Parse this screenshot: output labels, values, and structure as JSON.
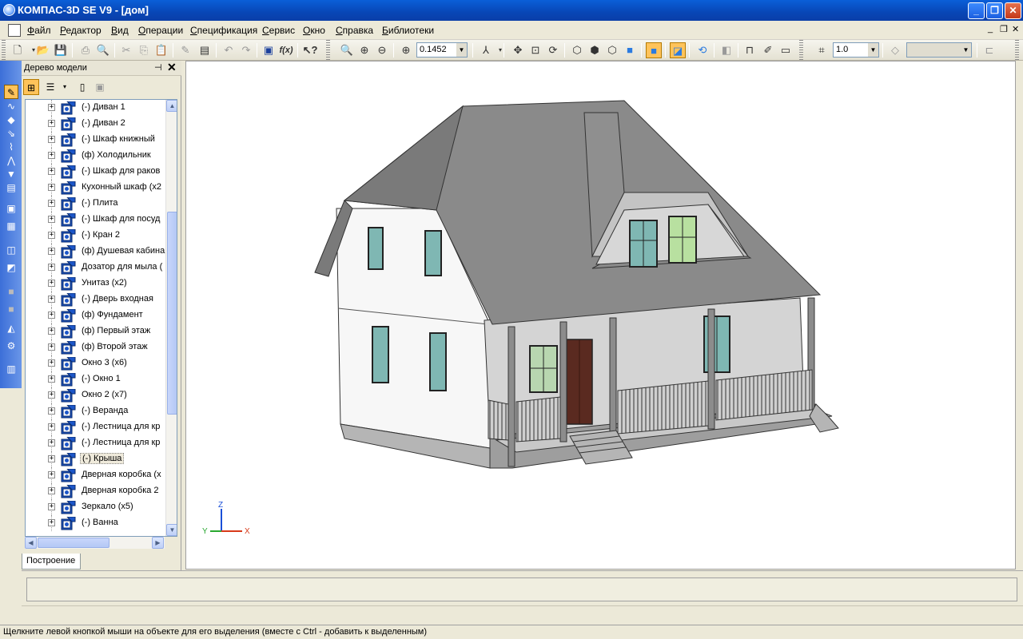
{
  "window": {
    "title": "КОМПАС-3D SE V9 - [дом]",
    "minimize_glyph": "_",
    "maximize_glyph": "❐",
    "close_glyph": "✕"
  },
  "menu": {
    "items": [
      "Файл",
      "Редактор",
      "Вид",
      "Операции",
      "Спецификация",
      "Сервис",
      "Окно",
      "Справка",
      "Библиотеки"
    ],
    "mdi_minimize": "_",
    "mdi_restore": "❐",
    "mdi_close": "✕"
  },
  "toolbar": {
    "zoom_value": "0.1452",
    "step_value": "1.0",
    "layer_value": "",
    "icons": [
      "new-document",
      "open",
      "save",
      "print",
      "print-preview",
      "cut",
      "copy",
      "paste",
      "properties",
      "undo",
      "redo",
      "insert-object",
      "variables",
      "help-pointer",
      "zoom-window",
      "zoom-in",
      "zoom-out",
      "zoom-scale",
      "orientation",
      "pan",
      "zoom-all",
      "rotate",
      "wireframe",
      "hidden-lines",
      "hidden-lines-dim",
      "halftone",
      "halftone-edges",
      "perspective",
      "rebuild",
      "section",
      "measure",
      "draw-settings",
      "show-all",
      "step"
    ]
  },
  "compact_panel": {
    "icons": [
      "edit-icon",
      "curves-icon",
      "surfaces-icon",
      "arrays-icon",
      "auxiliary-icon",
      "sketch-icon",
      "filter-icon",
      "spec-icon",
      "cube-icon",
      "open-folder-icon",
      "cube2-icon",
      "cube3-icon",
      "gray1-icon",
      "gray2-icon",
      "measure-icon",
      "gear-icon",
      "library-icon"
    ]
  },
  "tree_panel": {
    "title": "Дерево модели",
    "pin_glyph": "⊣",
    "close_glyph": "✕",
    "tab_label": "Построение",
    "items": [
      {
        "label": "(-) Диван 1"
      },
      {
        "label": "(-) Диван 2"
      },
      {
        "label": "(-) Шкаф книжный"
      },
      {
        "label": "(ф) Холодильник"
      },
      {
        "label": "(-) Шкаф для раков"
      },
      {
        "label": "Кухонный шкаф (х2"
      },
      {
        "label": "(-) Плита"
      },
      {
        "label": "(-) Шкаф для посуд"
      },
      {
        "label": "(-) Кран 2"
      },
      {
        "label": "(ф) Душевая кабина"
      },
      {
        "label": "Дозатор для мыла ("
      },
      {
        "label": "Унитаз (х2)"
      },
      {
        "label": "(-) Дверь входная"
      },
      {
        "label": "(ф) Фундамент"
      },
      {
        "label": "(ф) Первый этаж"
      },
      {
        "label": "(ф) Второй этаж"
      },
      {
        "label": "Окно 3 (х6)"
      },
      {
        "label": "(-) Окно 1"
      },
      {
        "label": "Окно 2 (х7)"
      },
      {
        "label": "(-) Веранда"
      },
      {
        "label": "(-) Лестница для кр"
      },
      {
        "label": "(-) Лестница для кр"
      },
      {
        "label": "(-) Крыша",
        "selected": true
      },
      {
        "label": "Дверная коробка (х"
      },
      {
        "label": "Дверная коробка 2"
      },
      {
        "label": "Зеркало (х5)"
      },
      {
        "label": "(-) Ванна"
      }
    ]
  },
  "axes": {
    "x": "X",
    "y": "Y",
    "z": "Z"
  },
  "status_bar": {
    "text": "Щелкните левой кнопкой мыши на объекте для его выделения (вместе с Ctrl - добавить к выделенным)"
  }
}
